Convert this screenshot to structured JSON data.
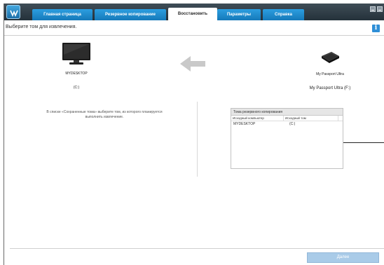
{
  "header": {
    "tabs": [
      {
        "label": "Главная страница"
      },
      {
        "label": "Резервное копирование"
      },
      {
        "label": "Восстановить"
      },
      {
        "label": "Параметры"
      },
      {
        "label": "Справка"
      }
    ],
    "active_tab": "Восстановить"
  },
  "subheader": {
    "prompt": "Выберите том для извлечения.",
    "info_icon": "i"
  },
  "source_device": {
    "name": "MYDESKTOP",
    "volume": "(C:)",
    "icon": "monitor-icon"
  },
  "target_device": {
    "name": "My Passport Ultra",
    "volume": "My Passport Ultra (F:)",
    "icon": "external-drive-icon"
  },
  "instructions": "В списке «Сохраненные тома» выберите том, из которого планируется выполнить извлечение.",
  "volumes": {
    "title": "Тома резервного копирования",
    "columns": [
      "Исходный компьютер",
      "Исходный том"
    ],
    "rows": [
      {
        "computer": "MYDESKTOP",
        "volume": "(C:)"
      }
    ]
  },
  "footer": {
    "next_label": "Далее"
  },
  "colors": {
    "tab_blue": "#1e8bd0",
    "titlebar": "#2e3b44",
    "next_disabled": "#a9cbe8"
  }
}
